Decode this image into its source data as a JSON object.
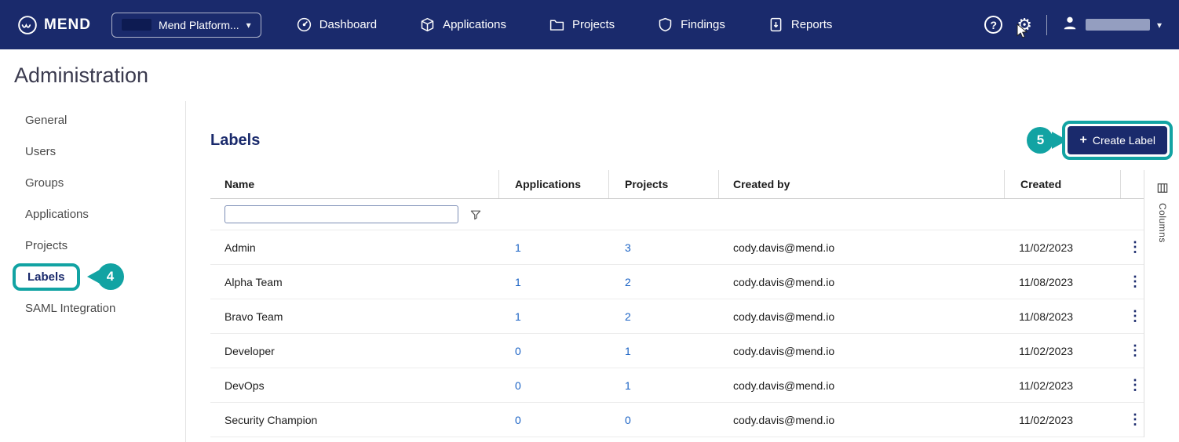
{
  "colors": {
    "navbar": "#1A2A6C",
    "accent_teal": "#12A3A3",
    "link_blue": "#1B63C5",
    "button": "#1A2A6C"
  },
  "icons": {
    "kebab": "⋮",
    "help": "?",
    "chevron_down": "▾",
    "plus": "+",
    "gear": "⚙"
  },
  "navbar": {
    "brand": "MEND",
    "platform_selector": {
      "label": "Mend Platform..."
    },
    "items": [
      {
        "label": "Dashboard",
        "icon": "dashboard-icon"
      },
      {
        "label": "Applications",
        "icon": "applications-icon"
      },
      {
        "label": "Projects",
        "icon": "projects-icon"
      },
      {
        "label": "Findings",
        "icon": "findings-icon"
      },
      {
        "label": "Reports",
        "icon": "reports-icon"
      }
    ]
  },
  "page": {
    "title": "Administration"
  },
  "sidebar": {
    "items": [
      {
        "label": "General"
      },
      {
        "label": "Users"
      },
      {
        "label": "Groups"
      },
      {
        "label": "Applications"
      },
      {
        "label": "Projects"
      },
      {
        "label": "Labels",
        "active": true
      },
      {
        "label": "SAML Integration"
      }
    ]
  },
  "annotations": {
    "step4": "4",
    "step5": "5"
  },
  "main": {
    "title": "Labels",
    "create_button": {
      "label": "Create Label"
    },
    "columns_label": "Columns",
    "filter": {
      "value": ""
    },
    "table": {
      "headers": [
        "Name",
        "Applications",
        "Projects",
        "Created by",
        "Created"
      ],
      "rows": [
        {
          "name": "Admin",
          "applications": "1",
          "projects": "3",
          "created_by": "cody.davis@mend.io",
          "created": "11/02/2023"
        },
        {
          "name": "Alpha Team",
          "applications": "1",
          "projects": "2",
          "created_by": "cody.davis@mend.io",
          "created": "11/08/2023"
        },
        {
          "name": "Bravo Team",
          "applications": "1",
          "projects": "2",
          "created_by": "cody.davis@mend.io",
          "created": "11/08/2023"
        },
        {
          "name": "Developer",
          "applications": "0",
          "projects": "1",
          "created_by": "cody.davis@mend.io",
          "created": "11/02/2023"
        },
        {
          "name": "DevOps",
          "applications": "0",
          "projects": "1",
          "created_by": "cody.davis@mend.io",
          "created": "11/02/2023"
        },
        {
          "name": "Security Champion",
          "applications": "0",
          "projects": "0",
          "created_by": "cody.davis@mend.io",
          "created": "11/02/2023"
        }
      ]
    }
  }
}
